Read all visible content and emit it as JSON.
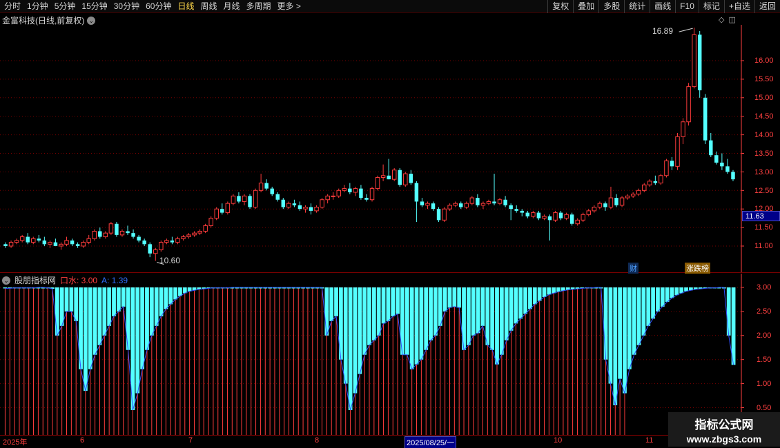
{
  "toolbar": {
    "periods": [
      "分时",
      "1分钟",
      "5分钟",
      "15分钟",
      "30分钟",
      "60分钟",
      "日线",
      "周线",
      "月线",
      "多周期",
      "更多 >"
    ],
    "active_period": "日线",
    "tools": [
      "复权",
      "叠加",
      "多股",
      "统计",
      "画线",
      "F10",
      "标记",
      "+自选",
      "返回"
    ]
  },
  "stock": {
    "title": "金富科技(日线,前复权)"
  },
  "price_axis": {
    "ticks": [
      "16.00",
      "15.50",
      "15.00",
      "14.50",
      "14.00",
      "13.50",
      "13.00",
      "12.50",
      "12.00",
      "11.50",
      "11.00"
    ],
    "current": "11.63"
  },
  "annotations": {
    "high": "16.89",
    "low": "10.60",
    "badge_cai": "财",
    "badge_zr": "涨跌榜"
  },
  "indicator": {
    "name": "股朋指标网",
    "v1": "口水: 3.00",
    "v2": "A: 1.39",
    "ticks": [
      "3.00",
      "2.50",
      "2.00",
      "1.50",
      "1.00",
      "0.50"
    ]
  },
  "date_axis": {
    "labels": [
      "2025年",
      "6",
      "7",
      "8",
      "10",
      "11"
    ],
    "cursor_date": "2025/08/25/一"
  },
  "watermark": {
    "line1": "指标公式网",
    "line2": "www.zbgs3.com"
  },
  "colors": {
    "up": "#ff3c3c",
    "down": "#54ffff",
    "grid": "#7a0000",
    "axis": "#ff4040",
    "line_a": "#3050ff"
  },
  "chart_data": {
    "type": "candlestick",
    "ohlc": [
      [
        11.05,
        11.1,
        10.95,
        11.0
      ],
      [
        11.0,
        11.15,
        10.95,
        11.1
      ],
      [
        11.1,
        11.2,
        11.05,
        11.15
      ],
      [
        11.15,
        11.3,
        11.1,
        11.25
      ],
      [
        11.25,
        11.35,
        11.05,
        11.1
      ],
      [
        11.1,
        11.25,
        11.05,
        11.2
      ],
      [
        11.2,
        11.3,
        11.1,
        11.15
      ],
      [
        11.15,
        11.25,
        11.0,
        11.05
      ],
      [
        11.05,
        11.15,
        10.95,
        11.1
      ],
      [
        11.1,
        11.2,
        11.0,
        11.0
      ],
      [
        11.0,
        11.1,
        10.9,
        11.05
      ],
      [
        11.05,
        11.25,
        11.0,
        11.15
      ],
      [
        11.15,
        11.2,
        11.0,
        11.05
      ],
      [
        11.05,
        11.1,
        10.95,
        11.0
      ],
      [
        11.0,
        11.15,
        10.95,
        11.1
      ],
      [
        11.1,
        11.3,
        11.05,
        11.2
      ],
      [
        11.2,
        11.45,
        11.15,
        11.4
      ],
      [
        11.4,
        11.5,
        11.2,
        11.25
      ],
      [
        11.25,
        11.4,
        11.2,
        11.35
      ],
      [
        11.35,
        11.65,
        11.3,
        11.6
      ],
      [
        11.6,
        11.65,
        11.25,
        11.3
      ],
      [
        11.3,
        11.45,
        11.25,
        11.4
      ],
      [
        11.4,
        11.55,
        11.3,
        11.35
      ],
      [
        11.35,
        11.45,
        11.2,
        11.25
      ],
      [
        11.25,
        11.3,
        11.1,
        11.15
      ],
      [
        11.15,
        11.2,
        11.0,
        11.05
      ],
      [
        11.05,
        11.1,
        10.7,
        10.8
      ],
      [
        10.8,
        10.95,
        10.6,
        10.9
      ],
      [
        10.9,
        11.15,
        10.85,
        11.1
      ],
      [
        11.1,
        11.2,
        11.05,
        11.15
      ],
      [
        11.15,
        11.25,
        11.05,
        11.1
      ],
      [
        11.1,
        11.25,
        11.05,
        11.2
      ],
      [
        11.2,
        11.3,
        11.15,
        11.25
      ],
      [
        11.25,
        11.35,
        11.2,
        11.3
      ],
      [
        11.3,
        11.4,
        11.25,
        11.35
      ],
      [
        11.35,
        11.45,
        11.3,
        11.4
      ],
      [
        11.4,
        11.6,
        11.35,
        11.55
      ],
      [
        11.55,
        11.8,
        11.5,
        11.75
      ],
      [
        11.75,
        12.05,
        11.7,
        12.0
      ],
      [
        12.0,
        12.15,
        11.85,
        11.9
      ],
      [
        11.9,
        12.2,
        11.85,
        12.15
      ],
      [
        12.15,
        12.4,
        12.1,
        12.35
      ],
      [
        12.35,
        12.45,
        12.15,
        12.2
      ],
      [
        12.2,
        12.4,
        12.1,
        12.35
      ],
      [
        12.35,
        12.4,
        12.0,
        12.05
      ],
      [
        12.05,
        12.55,
        12.0,
        12.5
      ],
      [
        12.5,
        12.95,
        12.45,
        12.7
      ],
      [
        12.7,
        12.8,
        12.5,
        12.55
      ],
      [
        12.55,
        12.6,
        12.35,
        12.4
      ],
      [
        12.4,
        12.45,
        12.2,
        12.25
      ],
      [
        12.25,
        12.3,
        12.0,
        12.05
      ],
      [
        12.05,
        12.2,
        12.0,
        12.15
      ],
      [
        12.15,
        12.25,
        12.05,
        12.1
      ],
      [
        12.1,
        12.2,
        11.95,
        12.0
      ],
      [
        12.0,
        12.1,
        11.9,
        12.05
      ],
      [
        12.05,
        12.15,
        11.85,
        11.95
      ],
      [
        11.95,
        12.1,
        11.9,
        12.05
      ],
      [
        12.05,
        12.3,
        12.0,
        12.25
      ],
      [
        12.25,
        12.4,
        12.15,
        12.35
      ],
      [
        12.35,
        12.45,
        12.25,
        12.35
      ],
      [
        12.35,
        12.55,
        12.3,
        12.5
      ],
      [
        12.5,
        12.65,
        12.45,
        12.55
      ],
      [
        12.55,
        12.7,
        12.4,
        12.45
      ],
      [
        12.45,
        12.6,
        12.35,
        12.55
      ],
      [
        12.55,
        12.65,
        12.25,
        12.3
      ],
      [
        12.3,
        12.4,
        12.2,
        12.25
      ],
      [
        12.25,
        12.6,
        12.2,
        12.55
      ],
      [
        12.55,
        12.9,
        12.5,
        12.85
      ],
      [
        12.85,
        13.2,
        12.75,
        12.9
      ],
      [
        12.9,
        13.35,
        12.8,
        12.8
      ],
      [
        12.8,
        13.1,
        12.75,
        13.05
      ],
      [
        13.05,
        13.1,
        12.6,
        12.65
      ],
      [
        12.65,
        13.0,
        12.6,
        12.95
      ],
      [
        12.95,
        13.05,
        12.65,
        12.7
      ],
      [
        12.7,
        12.75,
        11.65,
        12.2
      ],
      [
        12.2,
        12.3,
        12.05,
        12.1
      ],
      [
        12.1,
        12.2,
        12.0,
        12.15
      ],
      [
        12.15,
        12.2,
        11.95,
        12.0
      ],
      [
        12.0,
        12.05,
        11.65,
        11.7
      ],
      [
        11.7,
        12.05,
        11.65,
        12.0
      ],
      [
        12.0,
        12.15,
        11.95,
        12.1
      ],
      [
        12.1,
        12.2,
        12.05,
        12.15
      ],
      [
        12.15,
        12.2,
        12.0,
        12.05
      ],
      [
        12.05,
        12.2,
        12.0,
        12.15
      ],
      [
        12.15,
        12.35,
        12.1,
        12.3
      ],
      [
        12.3,
        12.4,
        12.05,
        12.1
      ],
      [
        12.1,
        12.2,
        12.0,
        12.15
      ],
      [
        12.15,
        12.25,
        12.1,
        12.2
      ],
      [
        12.2,
        12.95,
        12.1,
        12.15
      ],
      [
        12.15,
        12.3,
        12.1,
        12.25
      ],
      [
        12.25,
        12.35,
        12.05,
        12.1
      ],
      [
        12.1,
        12.15,
        11.7,
        12.0
      ],
      [
        12.0,
        12.1,
        11.9,
        11.95
      ],
      [
        11.95,
        12.0,
        11.8,
        11.9
      ],
      [
        11.9,
        11.95,
        11.75,
        11.8
      ],
      [
        11.8,
        11.95,
        11.75,
        11.9
      ],
      [
        11.9,
        11.95,
        11.7,
        11.75
      ],
      [
        11.75,
        11.85,
        11.7,
        11.8
      ],
      [
        11.8,
        11.85,
        11.15,
        11.7
      ],
      [
        11.7,
        11.95,
        11.65,
        11.9
      ],
      [
        11.9,
        11.95,
        11.7,
        11.75
      ],
      [
        11.75,
        11.9,
        11.7,
        11.85
      ],
      [
        11.85,
        11.9,
        11.55,
        11.6
      ],
      [
        11.6,
        11.75,
        11.55,
        11.7
      ],
      [
        11.7,
        11.9,
        11.65,
        11.85
      ],
      [
        11.85,
        12.0,
        11.8,
        11.95
      ],
      [
        11.95,
        12.1,
        11.9,
        12.05
      ],
      [
        12.05,
        12.2,
        12.0,
        12.15
      ],
      [
        12.15,
        12.2,
        11.95,
        12.05
      ],
      [
        12.05,
        12.6,
        12.0,
        12.3
      ],
      [
        12.3,
        12.4,
        12.05,
        12.1
      ],
      [
        12.1,
        12.35,
        12.05,
        12.3
      ],
      [
        12.3,
        12.4,
        12.25,
        12.35
      ],
      [
        12.35,
        12.45,
        12.3,
        12.4
      ],
      [
        12.4,
        12.55,
        12.35,
        12.5
      ],
      [
        12.5,
        12.7,
        12.45,
        12.65
      ],
      [
        12.65,
        12.8,
        12.6,
        12.75
      ],
      [
        12.75,
        12.9,
        12.65,
        12.7
      ],
      [
        12.7,
        12.95,
        12.65,
        12.9
      ],
      [
        12.9,
        13.35,
        12.85,
        13.3
      ],
      [
        13.3,
        13.4,
        13.05,
        13.15
      ],
      [
        13.15,
        14.05,
        13.05,
        13.95
      ],
      [
        13.95,
        14.45,
        13.75,
        14.35
      ],
      [
        14.35,
        15.4,
        14.25,
        15.3
      ],
      [
        15.3,
        16.89,
        15.25,
        16.7
      ],
      [
        16.7,
        16.8,
        15.0,
        15.2
      ],
      [
        15.0,
        15.1,
        13.75,
        13.85
      ],
      [
        13.85,
        14.05,
        13.4,
        13.45
      ],
      [
        13.45,
        13.55,
        13.2,
        13.25
      ],
      [
        13.25,
        13.5,
        13.05,
        13.15
      ],
      [
        13.15,
        13.35,
        12.95,
        13.0
      ],
      [
        13.0,
        13.05,
        12.75,
        12.8
      ]
    ],
    "indicator": {
      "name": "股朋指标网",
      "mouth_water": [
        3.0,
        3.0,
        3.0,
        3.0,
        3.0,
        3.0,
        3.0,
        3.0,
        3.0,
        3.0,
        3.0,
        3.0,
        3.0,
        3.0,
        3.0,
        3.0,
        3.0,
        3.0,
        3.0,
        3.0,
        3.0,
        3.0,
        3.0,
        3.0,
        3.0,
        3.0,
        3.0,
        3.0,
        3.0,
        3.0,
        3.0,
        3.0,
        3.0,
        3.0,
        3.0,
        3.0,
        3.0,
        3.0,
        3.0,
        3.0,
        3.0,
        3.0,
        3.0,
        3.0,
        3.0,
        3.0,
        3.0,
        3.0,
        3.0,
        3.0,
        3.0,
        3.0,
        3.0,
        3.0,
        3.0,
        3.0,
        3.0,
        3.0,
        3.0,
        3.0,
        3.0,
        3.0,
        3.0,
        3.0,
        3.0,
        3.0,
        3.0,
        3.0,
        3.0,
        3.0,
        3.0,
        3.0,
        3.0,
        3.0,
        3.0,
        3.0,
        3.0,
        3.0,
        3.0,
        3.0,
        3.0,
        3.0,
        3.0,
        3.0,
        3.0,
        3.0,
        3.0,
        3.0,
        3.0,
        3.0,
        3.0,
        3.0,
        3.0,
        3.0,
        3.0,
        3.0,
        3.0,
        3.0,
        3.0,
        3.0,
        3.0,
        3.0,
        3.0,
        3.0,
        3.0,
        3.0,
        3.0,
        3.0,
        3.0,
        3.0,
        3.0,
        3.0,
        3.0,
        3.0,
        3.0,
        3.0,
        3.0,
        3.0,
        3.0,
        3.0,
        3.0,
        3.0,
        3.0,
        3.0,
        3.0,
        3.0,
        3.0,
        3.0,
        3.0,
        3.0,
        3.0,
        3.0
      ],
      "a": [
        2.98,
        2.98,
        2.99,
        2.99,
        2.99,
        2.99,
        2.99,
        3.0,
        3.0,
        2.99,
        2.97,
        2.0,
        2.2,
        2.5,
        2.5,
        2.3,
        1.3,
        0.85,
        1.3,
        1.6,
        1.8,
        2.0,
        2.2,
        2.4,
        2.5,
        2.6,
        1.7,
        0.45,
        0.8,
        1.3,
        1.7,
        2.0,
        2.2,
        2.4,
        2.55,
        2.65,
        2.75,
        2.82,
        2.88,
        2.92,
        2.94,
        2.96,
        2.97,
        2.98,
        2.99,
        2.99,
        2.99,
        2.99,
        3.0,
        3.0,
        3.0,
        3.0,
        3.0,
        3.0,
        3.0,
        3.0,
        3.0,
        3.0,
        3.0,
        3.0,
        3.0,
        3.0,
        3.0,
        3.0,
        3.0,
        3.0,
        3.0,
        3.0,
        2.0,
        2.3,
        2.4,
        1.5,
        1.0,
        0.45,
        0.8,
        1.2,
        1.6,
        1.8,
        1.9,
        2.0,
        2.25,
        2.3,
        2.4,
        2.45,
        1.6,
        1.6,
        1.3,
        1.4,
        1.5,
        1.7,
        1.9,
        2.0,
        2.2,
        2.5,
        2.58,
        2.6,
        2.58,
        1.7,
        1.8,
        2.0,
        2.05,
        2.2,
        1.8,
        1.7,
        1.4,
        1.6,
        1.9,
        2.1,
        2.25,
        2.35,
        2.45,
        2.55,
        2.65,
        2.72,
        2.8,
        2.85,
        2.88,
        2.91,
        2.93,
        2.95,
        2.96,
        2.97,
        2.98,
        2.99,
        2.99,
        3.0,
        3.0,
        1.5,
        1.0,
        0.55,
        1.1,
        0.8,
        1.3,
        1.6,
        1.8,
        2.0,
        2.2,
        2.35,
        2.5,
        2.6,
        2.7,
        2.78,
        2.84,
        2.88,
        2.92,
        2.94,
        2.96,
        2.97,
        2.98,
        2.99,
        2.99,
        3.0,
        3.0,
        2.0,
        1.39
      ]
    }
  }
}
